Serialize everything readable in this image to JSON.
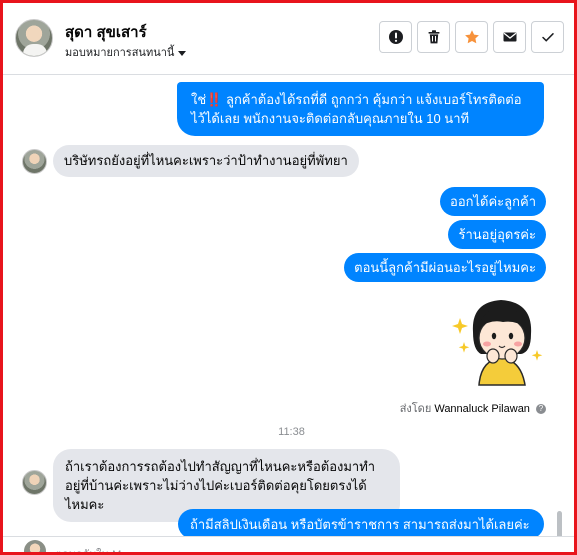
{
  "header": {
    "name": "สุดา สุขเสาร์",
    "assign_label": "มอบหมายการสนทนานี้"
  },
  "actions": [
    {
      "name": "mark-spam-button",
      "icon": "exclamation-circle-icon"
    },
    {
      "name": "delete-button",
      "icon": "trash-icon"
    },
    {
      "name": "star-button",
      "icon": "star-icon",
      "color": "#f7923b"
    },
    {
      "name": "email-button",
      "icon": "envelope-icon"
    },
    {
      "name": "done-button",
      "icon": "check-icon"
    }
  ],
  "messages": {
    "m1_before": "ใช่",
    "m1_emoji": "‼️",
    "m1_after": " ลูกค้าต้องได้รถที่ดี ถูกกว่า คุ้มกว่า แจ้งเบอร์โทรติดต่อไว้ได้เลย พนักงานจะติดต่อกลับคุณภายใน 10 นาที",
    "m2": "บริษัทรถยังอยู่ที่ไหนคะเพราะว่าป้าทำงานอยู่ที่พัทยา",
    "m3": "ออกได้ค่ะลูกค้า",
    "m4": "ร้านอยู่อุดรค่ะ",
    "m5": "ตอนนี้ลูกค้ามีผ่อนอะไรอยู่ไหมคะ",
    "sent_by_label": "ส่งโดย",
    "sent_by_name": "Wannaluck Pilawan",
    "time": "11:38",
    "m6": "ถ้าเราต้องการรถต้องไปทำสัญญาที่ไหนคะหรือต้องมาทำอยู่ที่บ้านค่ะเพราะไม่ว่างไปค่ะเบอร์ติดต่อคุยโดยตรงได้ไหมคะ",
    "m7": "ถ้ามีสลิปเงินเดือน หรือบัตรข้าราชการ สามารถส่งมาได้เลยค่ะ"
  },
  "composer": {
    "placeholder": "ตอบกลับใน Messenger"
  },
  "colors": {
    "outgoing": "#0084ff",
    "incoming": "#e4e6eb",
    "frame": "#e8141c"
  }
}
